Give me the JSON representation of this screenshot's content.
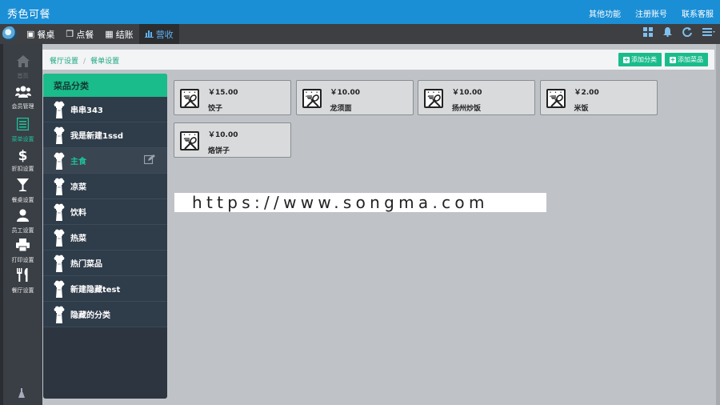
{
  "app": {
    "title": "秀色可餐"
  },
  "top_links": [
    "其他功能",
    "注册账号",
    "联系客服"
  ],
  "nav_tabs": [
    {
      "label": "餐桌",
      "icon": "table-icon",
      "active": false
    },
    {
      "label": "点餐",
      "icon": "book-icon",
      "active": false
    },
    {
      "label": "结账",
      "icon": "calculator-icon",
      "active": false
    },
    {
      "label": "营收",
      "icon": "bar-chart-icon",
      "active": true
    }
  ],
  "nav_icons": [
    "grid-icon",
    "bell-icon",
    "refresh-icon",
    "menu-list-icon"
  ],
  "left_menu": [
    {
      "label": "首页",
      "icon": "home-icon",
      "state": "dim"
    },
    {
      "label": "会员管理",
      "icon": "users-icon",
      "state": "normal"
    },
    {
      "label": "菜单设置",
      "icon": "menu-book-icon",
      "state": "active"
    },
    {
      "label": "折扣设置",
      "icon": "dollar-icon",
      "state": "normal"
    },
    {
      "label": "餐桌设置",
      "icon": "cocktail-icon",
      "state": "normal"
    },
    {
      "label": "员工设置",
      "icon": "user-icon",
      "state": "normal"
    },
    {
      "label": "打印设置",
      "icon": "printer-icon",
      "state": "normal"
    },
    {
      "label": "餐厅设置",
      "icon": "utensils-icon",
      "state": "normal"
    }
  ],
  "breadcrumb": {
    "root": "餐厅设置",
    "current": "餐单设置"
  },
  "buttons": {
    "add_category": "添加分类",
    "add_dish": "添加菜品"
  },
  "category_panel": {
    "title": "菜品分类",
    "items": [
      {
        "label": "串串343",
        "active": false
      },
      {
        "label": "我是新建1ssd",
        "active": false
      },
      {
        "label": "主食",
        "active": true
      },
      {
        "label": "凉菜",
        "active": false
      },
      {
        "label": "饮料",
        "active": false
      },
      {
        "label": "热菜",
        "active": false
      },
      {
        "label": "热门菜品",
        "active": false
      },
      {
        "label": "新建隐藏test",
        "active": false
      },
      {
        "label": "隐藏的分类",
        "active": false
      }
    ]
  },
  "dishes": [
    {
      "price": "￥15.00",
      "name": "饺子"
    },
    {
      "price": "￥10.00",
      "name": "龙须面"
    },
    {
      "price": "￥10.00",
      "name": "扬州炒饭"
    },
    {
      "price": "￥2.00",
      "name": "米饭"
    },
    {
      "price": "￥10.00",
      "name": "烙饼子"
    }
  ],
  "watermark": "https://www.songma.com",
  "colors": {
    "topbar": "#1b8fd6",
    "accent_green": "#1abc8c",
    "nav_dark": "#3d3f43",
    "panel_dark": "#2c3540"
  }
}
